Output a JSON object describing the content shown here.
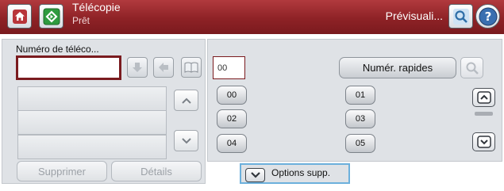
{
  "header": {
    "title": "Télécopie",
    "status": "Prêt",
    "preview_label": "Prévisuali...",
    "icons": [
      "home-icon",
      "fax-start-icon",
      "preview-icon",
      "help-icon"
    ]
  },
  "fax_entry": {
    "label": "Numéro de téléco...",
    "value": "",
    "icons": [
      "arrow-down-icon",
      "backspace-arrow-icon",
      "phone-book-icon"
    ]
  },
  "recipient_list": {
    "rows": [
      "",
      "",
      ""
    ],
    "icons": [
      "chevron-up-icon",
      "chevron-down-icon"
    ]
  },
  "footer_left": {
    "delete_label": "Supprimer",
    "details_label": "Détails"
  },
  "speed_dial": {
    "input_value": "00",
    "button_label": "Numér. rapides",
    "codes": [
      "00",
      "01",
      "02",
      "03",
      "04",
      "05"
    ],
    "icons": [
      "search-icon",
      "scroll-up-icon",
      "scroll-down-icon"
    ]
  },
  "options": {
    "label": "Options supp.",
    "icon": "expand-down-icon"
  },
  "colors": {
    "title_bar": "#8e2226",
    "panel": "#dfe2e6",
    "input_border": "#7a1b1f",
    "focus_outline": "#6cb0dc",
    "start_green": "#2e9b3f"
  }
}
